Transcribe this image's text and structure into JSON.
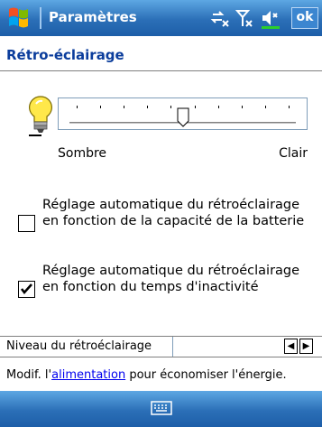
{
  "titlebar": {
    "app_title": "Paramètres",
    "ok_label": "ok",
    "icons": [
      "windows-start-icon",
      "connectivity-icon",
      "signal-icon",
      "volume-icon"
    ]
  },
  "page": {
    "heading": "Rétro-éclairage"
  },
  "brightness": {
    "icon": "lightbulb-icon",
    "min_label": "Sombre",
    "max_label": "Clair",
    "tick_count": 10,
    "level_fraction": 0.5
  },
  "options": [
    {
      "label": "Réglage automatique du rétroéclairage en fonction de la capacité de la batterie",
      "checked": false
    },
    {
      "label": "Réglage automatique du rétroéclairage en fonction du temps d'inactivité",
      "checked": true
    }
  ],
  "level": {
    "label": "Niveau du rétroéclairage",
    "left_arrow": "◀",
    "right_arrow": "▶"
  },
  "hint": {
    "prefix": "Modif. l'",
    "link": "alimentation",
    "suffix": " pour économiser l'énergie."
  },
  "menubar": {
    "icon": "keyboard-icon"
  },
  "colors": {
    "bar_top": "#5da7e3",
    "bar_bottom": "#1d5ea8",
    "heading": "#0b3d9c",
    "link": "#0000ee"
  }
}
